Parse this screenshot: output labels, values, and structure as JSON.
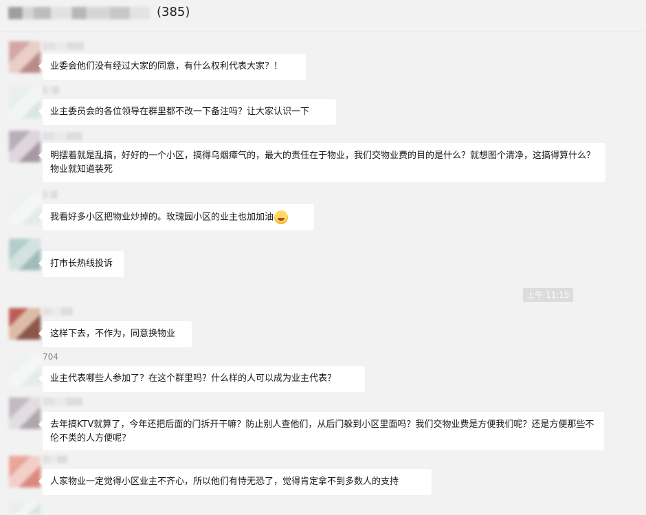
{
  "header": {
    "member_count": "(385)"
  },
  "divider": {
    "time": "上午 11:15"
  },
  "messages": [
    {
      "text": "业委会他们没有经过大家的同意，有什么权利代表大家？！"
    },
    {
      "text": "业主委员会的各位领导在群里都不改一下备注吗？让大家认识一下"
    },
    {
      "text": "明摆着就是乱搞，好好的一个小区，搞得乌烟瘴气的，最大的责任在于物业，我们交物业费的目的是什么？就想图个清净，这搞得算什么？物业就知道装死"
    },
    {
      "text": "我看好多小区把物业炒掉的。玫瑰园小区的业主也加加油",
      "emoji": "grin-emoji"
    },
    {
      "text": "打市长热线投诉"
    },
    {
      "text": "这样下去，不作为，同意换物业"
    },
    {
      "sender": "704",
      "text": "业主代表哪些人参加了？在这个群里吗？什么样的人可以成为业主代表？"
    },
    {
      "text": "去年搞KTV就算了，今年还把后面的门拆开干嘛？防止别人查他们，从后门躲到小区里面吗？我们交物业费是方便我们呢？还是方便那些不伦不类的人方便呢？"
    },
    {
      "text": "人家物业一定觉得小区业主不齐心，所以他们有恃无恐了，觉得肯定拿不到多数人的支持"
    }
  ]
}
